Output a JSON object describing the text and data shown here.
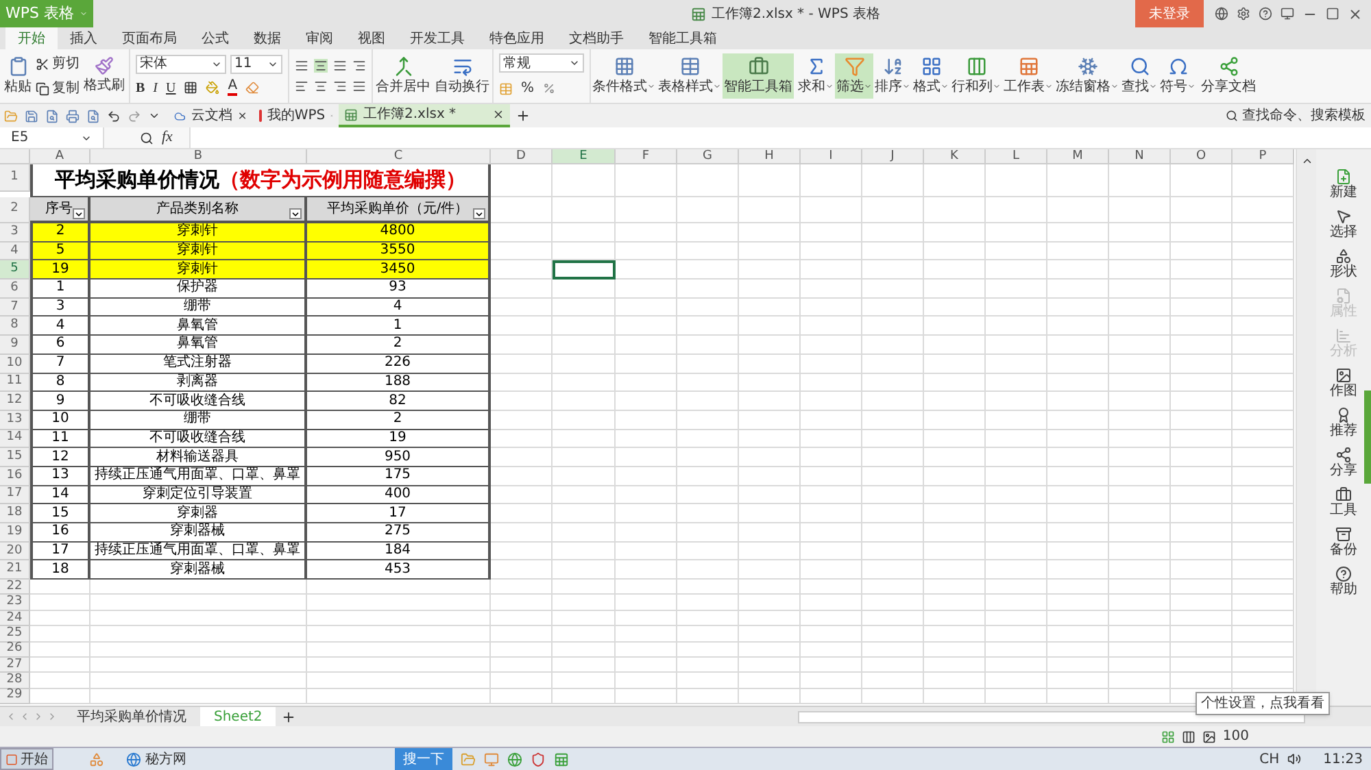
{
  "title_bar": {
    "app": "WPS 表格",
    "document": "工作簿2.xlsx * - WPS 表格",
    "login": "未登录"
  },
  "menu_tabs": [
    {
      "label": "开始",
      "selected": true
    },
    {
      "label": "插入",
      "selected": false
    },
    {
      "label": "页面布局",
      "selected": false
    },
    {
      "label": "公式",
      "selected": false
    },
    {
      "label": "数据",
      "selected": false
    },
    {
      "label": "审阅",
      "selected": false
    },
    {
      "label": "视图",
      "selected": false
    },
    {
      "label": "开发工具",
      "selected": false
    },
    {
      "label": "特色应用",
      "selected": false
    },
    {
      "label": "文档助手",
      "selected": false
    },
    {
      "label": "智能工具箱",
      "selected": false
    }
  ],
  "ribbon": {
    "clipboard": {
      "paste": "粘贴",
      "cut": "剪切",
      "copy": "复制",
      "format_painter": "格式刷"
    },
    "font": {
      "name": "宋体",
      "size": "11",
      "bold": "B",
      "italic": "I",
      "underline": "U",
      "font_color": "A"
    },
    "alignment": {
      "merge": "合并居中",
      "wrap": "自动换行"
    },
    "number": {
      "format": "常规",
      "percent": "%"
    },
    "tools": [
      {
        "label": "条件格式",
        "dropdown": true,
        "active": false
      },
      {
        "label": "表格样式",
        "dropdown": true,
        "active": false
      },
      {
        "label": "智能工具箱",
        "dropdown": false,
        "active": true
      },
      {
        "label": "求和",
        "dropdown": true,
        "active": false
      },
      {
        "label": "筛选",
        "dropdown": true,
        "active": true
      },
      {
        "label": "排序",
        "dropdown": true,
        "active": false
      },
      {
        "label": "格式",
        "dropdown": true,
        "active": false
      },
      {
        "label": "行和列",
        "dropdown": true,
        "active": false
      },
      {
        "label": "工作表",
        "dropdown": true,
        "active": false
      },
      {
        "label": "冻结窗格",
        "dropdown": true,
        "active": false
      },
      {
        "label": "查找",
        "dropdown": true,
        "active": false
      },
      {
        "label": "符号",
        "dropdown": true,
        "active": false
      },
      {
        "label": "分享文档",
        "dropdown": false,
        "active": false
      }
    ]
  },
  "search_command": "查找命令、搜索模板",
  "doc_tabs": [
    {
      "label": "云文档",
      "selected": false
    },
    {
      "label": "我的WPS",
      "selected": false
    },
    {
      "label": "工作簿2.xlsx *",
      "selected": true
    }
  ],
  "formula_bar": {
    "name_box": "E5",
    "fx": "fx"
  },
  "columns": [
    {
      "label": "A",
      "selected": false
    },
    {
      "label": "B",
      "selected": false
    },
    {
      "label": "C",
      "selected": false
    },
    {
      "label": "D",
      "selected": false
    },
    {
      "label": "E",
      "selected": true
    },
    {
      "label": "F",
      "selected": false
    },
    {
      "label": "G",
      "selected": false
    },
    {
      "label": "H",
      "selected": false
    },
    {
      "label": "I",
      "selected": false
    },
    {
      "label": "J",
      "selected": false
    },
    {
      "label": "K",
      "selected": false
    },
    {
      "label": "L",
      "selected": false
    },
    {
      "label": "M",
      "selected": false
    },
    {
      "label": "N",
      "selected": false
    },
    {
      "label": "O",
      "selected": false
    },
    {
      "label": "P",
      "selected": false
    }
  ],
  "rows": [
    {
      "label": "1",
      "selected": false
    },
    {
      "label": "2",
      "selected": false
    },
    {
      "label": "3",
      "selected": false
    },
    {
      "label": "4",
      "selected": false
    },
    {
      "label": "5",
      "selected": true
    },
    {
      "label": "6",
      "selected": false
    },
    {
      "label": "7",
      "selected": false
    },
    {
      "label": "8",
      "selected": false
    },
    {
      "label": "9",
      "selected": false
    },
    {
      "label": "10",
      "selected": false
    },
    {
      "label": "11",
      "selected": false
    },
    {
      "label": "12",
      "selected": false
    },
    {
      "label": "13",
      "selected": false
    },
    {
      "label": "14",
      "selected": false
    },
    {
      "label": "15",
      "selected": false
    },
    {
      "label": "16",
      "selected": false
    },
    {
      "label": "17",
      "selected": false
    },
    {
      "label": "18",
      "selected": false
    },
    {
      "label": "19",
      "selected": false
    },
    {
      "label": "20",
      "selected": false
    },
    {
      "label": "21",
      "selected": false
    },
    {
      "label": "22",
      "selected": false
    },
    {
      "label": "23",
      "selected": false
    },
    {
      "label": "24",
      "selected": false
    },
    {
      "label": "25",
      "selected": false
    },
    {
      "label": "26",
      "selected": false
    },
    {
      "label": "27",
      "selected": false
    },
    {
      "label": "28",
      "selected": false
    },
    {
      "label": "29",
      "selected": false
    }
  ],
  "table": {
    "title": "平均采购单价情况",
    "title_note": "（数字为示例用随意编撰）",
    "headers": [
      "序号",
      "产品类别名称",
      "平均采购单价（元/件）"
    ],
    "rows": [
      {
        "cells": [
          "2",
          "穿刺针",
          "4800"
        ],
        "highlighted": true
      },
      {
        "cells": [
          "5",
          "穿刺针",
          "3550"
        ],
        "highlighted": true
      },
      {
        "cells": [
          "19",
          "穿刺针",
          "3450"
        ],
        "highlighted": true
      },
      {
        "cells": [
          "1",
          "保护器",
          "93"
        ],
        "highlighted": false
      },
      {
        "cells": [
          "3",
          "绷带",
          "4"
        ],
        "highlighted": false
      },
      {
        "cells": [
          "4",
          "鼻氧管",
          "1"
        ],
        "highlighted": false
      },
      {
        "cells": [
          "6",
          "鼻氧管",
          "2"
        ],
        "highlighted": false
      },
      {
        "cells": [
          "7",
          "笔式注射器",
          "226"
        ],
        "highlighted": false
      },
      {
        "cells": [
          "8",
          "剥离器",
          "188"
        ],
        "highlighted": false
      },
      {
        "cells": [
          "9",
          "不可吸收缝合线",
          "82"
        ],
        "highlighted": false
      },
      {
        "cells": [
          "10",
          "绷带",
          "2"
        ],
        "highlighted": false
      },
      {
        "cells": [
          "11",
          "不可吸收缝合线",
          "19"
        ],
        "highlighted": false
      },
      {
        "cells": [
          "12",
          "材料输送器具",
          "950"
        ],
        "highlighted": false
      },
      {
        "cells": [
          "13",
          "持续正压通气用面罩、口罩、鼻罩",
          "175"
        ],
        "highlighted": false
      },
      {
        "cells": [
          "14",
          "穿刺定位引导装置",
          "400"
        ],
        "highlighted": false
      },
      {
        "cells": [
          "15",
          "穿刺器",
          "17"
        ],
        "highlighted": false
      },
      {
        "cells": [
          "16",
          "穿刺器械",
          "275"
        ],
        "highlighted": false
      },
      {
        "cells": [
          "17",
          "持续正压通气用面罩、口罩、鼻罩",
          "184"
        ],
        "highlighted": false
      },
      {
        "cells": [
          "18",
          "穿刺器械",
          "453"
        ],
        "highlighted": false
      }
    ]
  },
  "sidebar": [
    {
      "label": "新建",
      "disabled": false
    },
    {
      "label": "选择",
      "disabled": false
    },
    {
      "label": "形状",
      "disabled": false
    },
    {
      "label": "属性",
      "disabled": true
    },
    {
      "label": "分析",
      "disabled": true
    },
    {
      "label": "作图",
      "disabled": false
    },
    {
      "label": "推荐",
      "disabled": false
    },
    {
      "label": "分享",
      "disabled": false
    },
    {
      "label": "工具",
      "disabled": false
    },
    {
      "label": "备份",
      "disabled": false
    },
    {
      "label": "帮助",
      "disabled": false
    }
  ],
  "sheet_tabs": [
    {
      "label": "平均采购单价情况",
      "selected": false
    },
    {
      "label": "Sheet2",
      "selected": true
    }
  ],
  "status_bar": {
    "zoom": "100"
  },
  "tooltip": "个性设置，点我看看",
  "taskbar": {
    "start": "开始",
    "items": [
      "秘方网"
    ],
    "search": "搜一下",
    "language": "CH",
    "clock": "11:23"
  }
}
